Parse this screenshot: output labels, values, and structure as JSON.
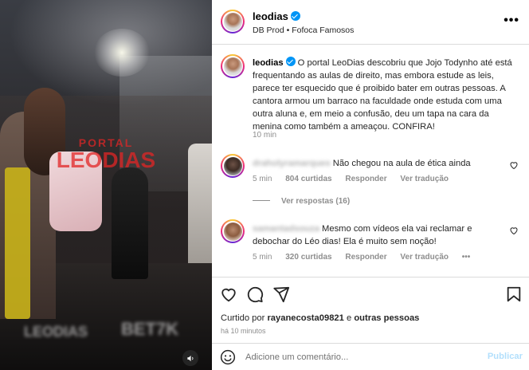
{
  "video": {
    "watermark_line1": "PORTAL",
    "watermark_line2": "LEODIAS",
    "logo_bottom_left": "LEODIAS",
    "logo_bottom_right": "BET7K"
  },
  "post": {
    "username": "leodias",
    "verified": true,
    "location": "DB Prod • Fofoca Famosos",
    "more_label": "•••"
  },
  "caption": {
    "username": "leodias",
    "text": "O portal LeoDias descobriu que Jojo Todynho até está frequentando as aulas de direito, mas embora estude as leis, parece ter esquecido que é proibido bater em outras pessoas. A cantora armou um barraco na faculdade onde estuda com uma outra aluna e, em meio a confusão, deu um tapa na cara da menina como também a ameaçou. CONFIRA!",
    "time": "10 min"
  },
  "comments": [
    {
      "username": "draholyramarques",
      "text": "Não chegou na aula de ética ainda",
      "time": "5 min",
      "likes": "804 curtidas",
      "reply": "Responder",
      "translate": "Ver tradução",
      "view_replies": "Ver respostas (16)"
    },
    {
      "username": "samantadsouza",
      "text": "Mesmo com vídeos ela vai reclamar e debochar do Léo dias! Ela é muito sem noção!",
      "time": "5 min",
      "likes": "320 curtidas",
      "reply": "Responder",
      "translate": "Ver tradução",
      "more": "•••"
    }
  ],
  "footer": {
    "liked_prefix": "Curtido por ",
    "liked_user": "rayanecosta09821",
    "liked_suffix": " e ",
    "liked_others": "outras pessoas",
    "posted_ago": "há 10 minutos",
    "comment_placeholder": "Adicione um comentário...",
    "publish_label": "Publicar"
  },
  "icons": [
    "verified-badge-icon",
    "more-options-icon",
    "heart-icon",
    "comment-icon",
    "share-icon",
    "bookmark-icon",
    "emoji-icon",
    "mute-icon"
  ],
  "colors": {
    "accent": "#0095f6",
    "publish_disabled": "#b2dffc",
    "muted_text": "#8e8e8e",
    "watermark": "#e22626"
  }
}
